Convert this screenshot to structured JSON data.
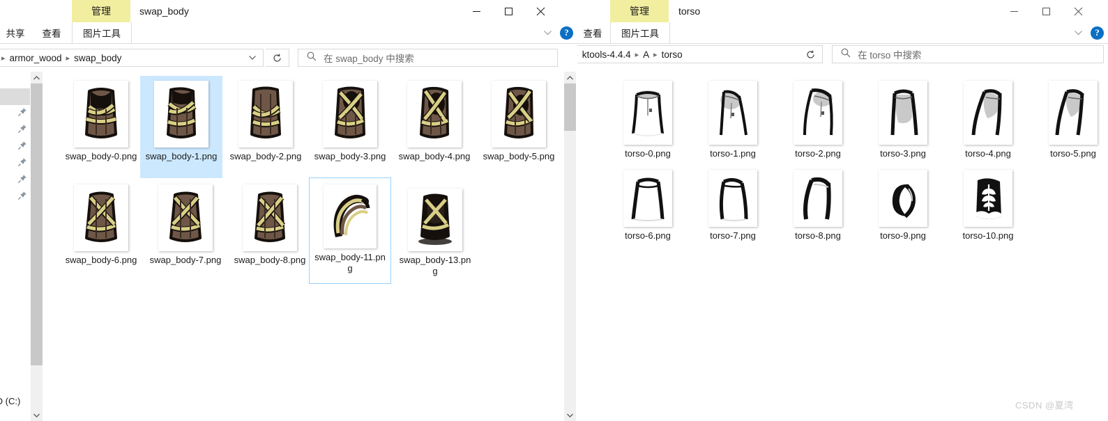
{
  "left_window": {
    "title": "swap_body",
    "manage_tab": "管理",
    "ribbon_tabs": [
      "共享",
      "查看",
      "图片工具"
    ],
    "active_ribbon_tab": "图片工具",
    "breadcrumbs": [
      "armor_wood",
      "swap_body"
    ],
    "search_placeholder": "在 swap_body 中搜索",
    "nav_label": "SD (C:)",
    "window_controls": {
      "minimize": "minimize-icon",
      "maximize": "maximize-icon",
      "close": "close-icon"
    },
    "help_label": "?",
    "files": [
      {
        "name": "swap_body-0.png",
        "state": "normal",
        "art": "armor"
      },
      {
        "name": "swap_body-1.png",
        "state": "selected",
        "art": "armor"
      },
      {
        "name": "swap_body-2.png",
        "state": "normal",
        "art": "armor"
      },
      {
        "name": "swap_body-3.png",
        "state": "normal",
        "art": "armor"
      },
      {
        "name": "swap_body-4.png",
        "state": "normal",
        "art": "armor"
      },
      {
        "name": "swap_body-5.png",
        "state": "normal",
        "art": "armor"
      },
      {
        "name": "swap_body-6.png",
        "state": "normal",
        "art": "armor"
      },
      {
        "name": "swap_body-7.png",
        "state": "normal",
        "art": "armor"
      },
      {
        "name": "swap_body-8.png",
        "state": "normal",
        "art": "armor"
      },
      {
        "name": "swap_body-11.png",
        "state": "focused",
        "art": "hook"
      },
      {
        "name": "swap_body-13.png",
        "state": "normal",
        "art": "dark"
      }
    ]
  },
  "right_window": {
    "title": "torso",
    "manage_tab": "管理",
    "ribbon_tabs": [
      "查看",
      "图片工具"
    ],
    "active_ribbon_tab": "图片工具",
    "breadcrumbs": [
      "ols",
      "ktools-4.4.4",
      "A",
      "torso"
    ],
    "search_placeholder": "在 torso 中搜索",
    "window_controls": {
      "minimize": "minimize-icon",
      "maximize": "maximize-icon",
      "close": "close-icon"
    },
    "help_label": "?",
    "files": [
      {
        "name": "torso-0.png",
        "art": "t0"
      },
      {
        "name": "torso-1.png",
        "art": "t1"
      },
      {
        "name": "torso-2.png",
        "art": "t2"
      },
      {
        "name": "torso-3.png",
        "art": "t3"
      },
      {
        "name": "torso-4.png",
        "art": "t4"
      },
      {
        "name": "torso-5.png",
        "art": "t5"
      },
      {
        "name": "torso-6.png",
        "art": "t6"
      },
      {
        "name": "torso-7.png",
        "art": "t7"
      },
      {
        "name": "torso-8.png",
        "art": "t8"
      },
      {
        "name": "torso-9.png",
        "art": "t9"
      },
      {
        "name": "torso-10.png",
        "art": "t10"
      }
    ]
  },
  "watermark": "CSDN @夏湾",
  "colors": {
    "manage_tab_bg": "#f2eea0",
    "selection_bg": "#cce8ff",
    "focus_border": "#99d1ff",
    "help_blue": "#0b6fc4",
    "scrollbar_thumb": "#c8c8c8",
    "armor_wood": "#6f5747",
    "armor_rope": "#d9cf86",
    "torso_gray": "#c9c9c9"
  }
}
